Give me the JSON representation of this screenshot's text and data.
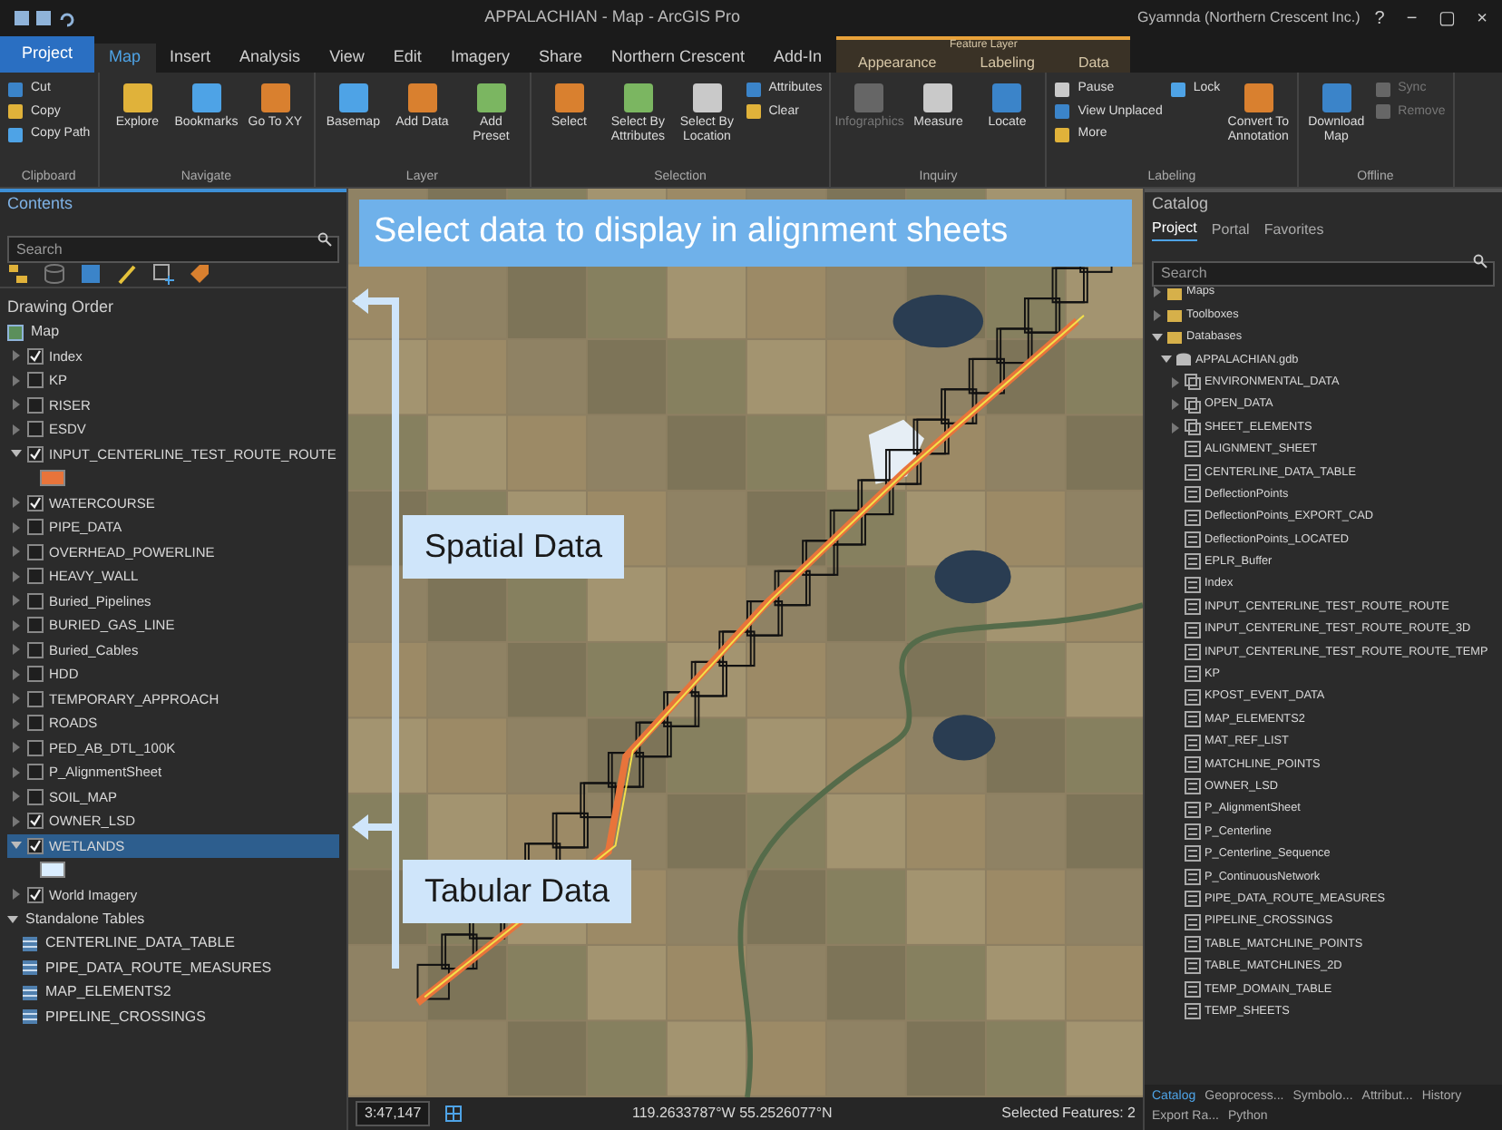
{
  "window": {
    "title": "APPALACHIAN - Map - ArcGIS Pro",
    "user": "Gyamnda (Northern Crescent Inc.)",
    "controls": [
      "?",
      "−",
      "▢",
      "×"
    ]
  },
  "contextual_label": "Feature Layer",
  "ribbon_tabs": [
    {
      "label": "Project",
      "kind": "file",
      "selected": false
    },
    {
      "label": "Map",
      "kind": "tab",
      "selected": true
    },
    {
      "label": "Insert",
      "kind": "tab",
      "selected": false
    },
    {
      "label": "Analysis",
      "kind": "tab",
      "selected": false
    },
    {
      "label": "View",
      "kind": "tab",
      "selected": false
    },
    {
      "label": "Edit",
      "kind": "tab",
      "selected": false
    },
    {
      "label": "Imagery",
      "kind": "tab",
      "selected": false
    },
    {
      "label": "Share",
      "kind": "tab",
      "selected": false
    },
    {
      "label": "Northern Crescent",
      "kind": "tab",
      "selected": false
    },
    {
      "label": "Add-In",
      "kind": "tab",
      "selected": false
    },
    {
      "label": "Appearance",
      "kind": "contextual",
      "selected": false
    },
    {
      "label": "Labeling",
      "kind": "contextual",
      "selected": false
    },
    {
      "label": "Data",
      "kind": "contextual",
      "selected": false
    }
  ],
  "ribbon_groups": [
    {
      "label": "Clipboard",
      "tools": [
        {
          "label": "Cut",
          "kind": "small",
          "disabled": false
        },
        {
          "label": "Copy",
          "kind": "small",
          "disabled": false
        },
        {
          "label": "Copy Path",
          "kind": "small",
          "disabled": false
        }
      ]
    },
    {
      "label": "Navigate",
      "tools": [
        {
          "label": "Explore",
          "kind": "large",
          "disabled": false
        },
        {
          "label": "Bookmarks",
          "kind": "large",
          "disabled": false
        },
        {
          "label": "Go To XY",
          "kind": "large",
          "disabled": false
        }
      ]
    },
    {
      "label": "Layer",
      "tools": [
        {
          "label": "Basemap",
          "kind": "large",
          "disabled": false
        },
        {
          "label": "Add Data",
          "kind": "large",
          "disabled": false
        },
        {
          "label": "Add Preset",
          "kind": "large",
          "disabled": false
        }
      ]
    },
    {
      "label": "Selection",
      "tools": [
        {
          "label": "Select",
          "kind": "large",
          "disabled": false
        },
        {
          "label": "Select By Attributes",
          "kind": "large",
          "disabled": false
        },
        {
          "label": "Select By Location",
          "kind": "large",
          "disabled": false
        },
        {
          "label": "Attributes",
          "kind": "small",
          "disabled": false
        },
        {
          "label": "Clear",
          "kind": "small",
          "disabled": false
        }
      ]
    },
    {
      "label": "Inquiry",
      "tools": [
        {
          "label": "Infographics",
          "kind": "large",
          "disabled": true
        },
        {
          "label": "Measure",
          "kind": "large",
          "disabled": false
        },
        {
          "label": "Locate",
          "kind": "large",
          "disabled": false
        }
      ]
    },
    {
      "label": "Labeling",
      "tools": [
        {
          "label": "Pause",
          "kind": "small",
          "disabled": false
        },
        {
          "label": "View Unplaced",
          "kind": "small",
          "disabled": false
        },
        {
          "label": "More",
          "kind": "small",
          "disabled": false
        },
        {
          "label": "Lock",
          "kind": "small",
          "disabled": false
        },
        {
          "label": "Convert To Annotation",
          "kind": "large",
          "disabled": false
        }
      ]
    },
    {
      "label": "Offline",
      "tools": [
        {
          "label": "Download Map",
          "kind": "large",
          "disabled": false
        },
        {
          "label": "Sync",
          "kind": "small",
          "disabled": true
        },
        {
          "label": "Remove",
          "kind": "small",
          "disabled": true
        }
      ]
    }
  ],
  "contents": {
    "title": "Contents",
    "search": {
      "placeholder": "Search"
    },
    "heading": "Drawing Order",
    "map_label": "Map",
    "rows": [
      {
        "kind": "layer",
        "label": "Index",
        "checked": true,
        "expanded": false,
        "selected": false
      },
      {
        "kind": "layer",
        "label": "KP",
        "checked": false,
        "expanded": false,
        "selected": false
      },
      {
        "kind": "layer",
        "label": "RISER",
        "checked": false,
        "expanded": false,
        "selected": false
      },
      {
        "kind": "layer",
        "label": "ESDV",
        "checked": false,
        "expanded": false,
        "selected": false
      },
      {
        "kind": "layer",
        "label": "INPUT_CENTERLINE_TEST_ROUTE_ROUTE",
        "checked": true,
        "expanded": true,
        "selected": false
      },
      {
        "kind": "swatch",
        "color": "#e8743b"
      },
      {
        "kind": "layer",
        "label": "WATERCOURSE",
        "checked": true,
        "expanded": false,
        "selected": false
      },
      {
        "kind": "layer",
        "label": "PIPE_DATA",
        "checked": false,
        "expanded": false,
        "selected": false
      },
      {
        "kind": "layer",
        "label": "OVERHEAD_POWERLINE",
        "checked": false,
        "expanded": false,
        "selected": false
      },
      {
        "kind": "layer",
        "label": "HEAVY_WALL",
        "checked": false,
        "expanded": false,
        "selected": false
      },
      {
        "kind": "layer",
        "label": "Buried_Pipelines",
        "checked": false,
        "expanded": false,
        "selected": false
      },
      {
        "kind": "layer",
        "label": "BURIED_GAS_LINE",
        "checked": false,
        "expanded": false,
        "selected": false
      },
      {
        "kind": "layer",
        "label": "Buried_Cables",
        "checked": false,
        "expanded": false,
        "selected": false
      },
      {
        "kind": "layer",
        "label": "HDD",
        "checked": false,
        "expanded": false,
        "selected": false
      },
      {
        "kind": "layer",
        "label": "TEMPORARY_APPROACH",
        "checked": false,
        "expanded": false,
        "selected": false
      },
      {
        "kind": "layer",
        "label": "ROADS",
        "checked": false,
        "expanded": false,
        "selected": false
      },
      {
        "kind": "layer",
        "label": "PED_AB_DTL_100K",
        "checked": false,
        "expanded": false,
        "selected": false
      },
      {
        "kind": "layer",
        "label": "P_AlignmentSheet",
        "checked": false,
        "expanded": false,
        "selected": false
      },
      {
        "kind": "layer",
        "label": "SOIL_MAP",
        "checked": false,
        "expanded": false,
        "selected": false
      },
      {
        "kind": "layer",
        "label": "OWNER_LSD",
        "checked": true,
        "expanded": false,
        "selected": false
      },
      {
        "kind": "layer",
        "label": "WETLANDS",
        "checked": true,
        "expanded": true,
        "selected": true
      },
      {
        "kind": "swatch",
        "color": "#dbeeff"
      },
      {
        "kind": "layer",
        "label": "World Imagery",
        "checked": true,
        "expanded": false,
        "selected": false
      },
      {
        "kind": "heading",
        "label": "Standalone Tables"
      },
      {
        "kind": "table",
        "label": "CENTERLINE_DATA_TABLE"
      },
      {
        "kind": "table",
        "label": "PIPE_DATA_ROUTE_MEASURES"
      },
      {
        "kind": "table",
        "label": "MAP_ELEMENTS2"
      },
      {
        "kind": "table",
        "label": "PIPELINE_CROSSINGS"
      }
    ]
  },
  "map": {
    "banner": "Select data to display in alignment sheets",
    "callouts": [
      "Spatial Data",
      "Tabular Data"
    ],
    "scale": "3:47,147",
    "coordinates": "119.2633787°W 55.2526077°N",
    "selected_features": "Selected Features: 2"
  },
  "catalog": {
    "title": "Catalog",
    "tabs": [
      {
        "label": "Project",
        "selected": true
      },
      {
        "label": "Portal",
        "selected": false
      },
      {
        "label": "Favorites",
        "selected": false
      }
    ],
    "search": {
      "placeholder": "Search"
    },
    "tree": [
      {
        "kind": "folder",
        "label": "Maps",
        "expanded": false
      },
      {
        "kind": "folder",
        "label": "Toolboxes",
        "expanded": false
      },
      {
        "kind": "folder",
        "label": "Databases",
        "expanded": true,
        "children": [
          {
            "kind": "database",
            "label": "APPALACHIAN.gdb",
            "expanded": true,
            "children": [
              {
                "kind": "dataset",
                "label": "ENVIRONMENTAL_DATA",
                "expanded": false
              },
              {
                "kind": "dataset",
                "label": "OPEN_DATA",
                "expanded": false
              },
              {
                "kind": "dataset",
                "label": "SHEET_ELEMENTS",
                "expanded": false
              },
              {
                "kind": "item",
                "label": "ALIGNMENT_SHEET"
              },
              {
                "kind": "item",
                "label": "CENTERLINE_DATA_TABLE"
              },
              {
                "kind": "item",
                "label": "DeflectionPoints"
              },
              {
                "kind": "item",
                "label": "DeflectionPoints_EXPORT_CAD"
              },
              {
                "kind": "item",
                "label": "DeflectionPoints_LOCATED"
              },
              {
                "kind": "item",
                "label": "EPLR_Buffer"
              },
              {
                "kind": "item",
                "label": "Index"
              },
              {
                "kind": "item",
                "label": "INPUT_CENTERLINE_TEST_ROUTE_ROUTE"
              },
              {
                "kind": "item",
                "label": "INPUT_CENTERLINE_TEST_ROUTE_ROUTE_3D"
              },
              {
                "kind": "item",
                "label": "INPUT_CENTERLINE_TEST_ROUTE_ROUTE_TEMP"
              },
              {
                "kind": "item",
                "label": "KP"
              },
              {
                "kind": "item",
                "label": "KPOST_EVENT_DATA"
              },
              {
                "kind": "item",
                "label": "MAP_ELEMENTS2"
              },
              {
                "kind": "item",
                "label": "MAT_REF_LIST"
              },
              {
                "kind": "item",
                "label": "MATCHLINE_POINTS"
              },
              {
                "kind": "item",
                "label": "OWNER_LSD"
              },
              {
                "kind": "item",
                "label": "P_AlignmentSheet"
              },
              {
                "kind": "item",
                "label": "P_Centerline"
              },
              {
                "kind": "item",
                "label": "P_Centerline_Sequence"
              },
              {
                "kind": "item",
                "label": "P_ContinuousNetwork"
              },
              {
                "kind": "item",
                "label": "PIPE_DATA_ROUTE_MEASURES"
              },
              {
                "kind": "item",
                "label": "PIPELINE_CROSSINGS"
              },
              {
                "kind": "item",
                "label": "TABLE_MATCHLINE_POINTS"
              },
              {
                "kind": "item",
                "label": "TABLE_MATCHLINES_2D"
              },
              {
                "kind": "item",
                "label": "TEMP_DOMAIN_TABLE"
              },
              {
                "kind": "item",
                "label": "TEMP_SHEETS"
              }
            ]
          }
        ]
      }
    ],
    "bottom_tabs": [
      {
        "label": "Catalog",
        "selected": true
      },
      {
        "label": "Geoprocess...",
        "selected": false
      },
      {
        "label": "Symbolo...",
        "selected": false
      },
      {
        "label": "Attribut...",
        "selected": false
      },
      {
        "label": "History",
        "selected": false
      },
      {
        "label": "Export Ra...",
        "selected": false
      },
      {
        "label": "Python",
        "selected": false
      }
    ]
  }
}
